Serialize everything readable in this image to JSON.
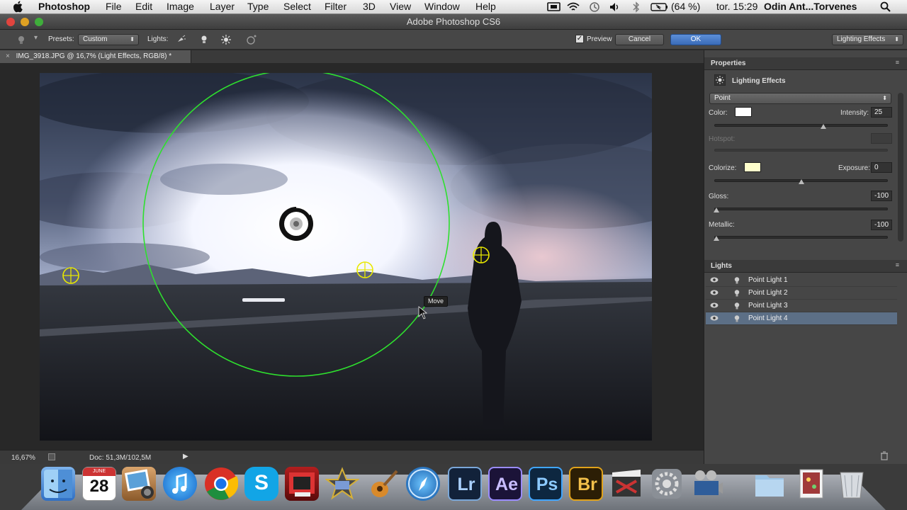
{
  "menubar": {
    "app_name": "Photoshop",
    "items": [
      "File",
      "Edit",
      "Image",
      "Layer",
      "Type",
      "Select",
      "Filter",
      "3D",
      "View",
      "Window",
      "Help"
    ],
    "battery": "(64 %)",
    "clock": "tor. 15:29",
    "user": "Odin Ant...Torvenes"
  },
  "window": {
    "title": "Adobe Photoshop CS6"
  },
  "options": {
    "presets_label": "Presets:",
    "preset_value": "Custom",
    "lights_label": "Lights:",
    "preview_label": "Preview",
    "preview_checked": true,
    "cancel_label": "Cancel",
    "ok_label": "OK",
    "workspace_value": "Lighting Effects"
  },
  "document": {
    "tab_title": "IMG_3918.JPG @ 16,7% (Light Effects, RGB/8) *",
    "move_tooltip": "Move"
  },
  "statusbar": {
    "zoom": "16,67%",
    "doc_info": "Doc: 51,3M/102,5M"
  },
  "properties": {
    "header": "Properties",
    "title": "Lighting Effects",
    "light_type": "Point",
    "color_label": "Color:",
    "color_value": "#ffffff",
    "intensity_label": "Intensity:",
    "intensity_value": "25",
    "hotspot_label": "Hotspot:",
    "colorize_label": "Colorize:",
    "colorize_value": "#ffffcc",
    "exposure_label": "Exposure:",
    "exposure_value": "0",
    "gloss_label": "Gloss:",
    "gloss_value": "-100",
    "metallic_label": "Metallic:",
    "metallic_value": "-100",
    "intensity_slider": 0.62,
    "exposure_slider": 0.5,
    "gloss_slider": 0.0,
    "metallic_slider": 0.0
  },
  "lights": {
    "header": "Lights",
    "items": [
      "Point Light 1",
      "Point Light 2",
      "Point Light 3",
      "Point Light 4"
    ],
    "selected_index": 3
  },
  "dock": {
    "calendar_month": "JUNE",
    "calendar_day": "28",
    "apps": [
      "Lr",
      "Ae",
      "Ps",
      "Br"
    ]
  },
  "colors": {
    "accent_blue": "#3a6bb8",
    "light_ring": "#2ee02e",
    "light_handle": "#e8e800"
  }
}
